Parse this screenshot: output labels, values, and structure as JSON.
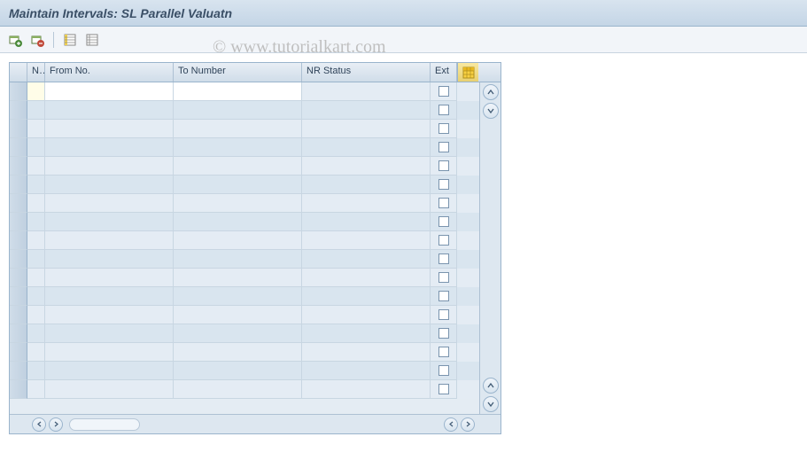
{
  "title": "Maintain Intervals: SL Parallel Valuatn",
  "watermark": "© www.tutorialkart.com",
  "toolbar": {
    "btn1_tip": "Insert Line",
    "btn2_tip": "Delete Line",
    "btn3_tip": "Select All",
    "btn4_tip": "Deselect All"
  },
  "table": {
    "headers": {
      "n": "N..",
      "from": "From No.",
      "to": "To Number",
      "nr": "NR Status",
      "ext": "Ext"
    },
    "rows": [
      {
        "n": "",
        "from": "",
        "to": "",
        "nr": "",
        "ext": false,
        "editable": true
      },
      {
        "n": "",
        "from": "",
        "to": "",
        "nr": "",
        "ext": false,
        "editable": false
      },
      {
        "n": "",
        "from": "",
        "to": "",
        "nr": "",
        "ext": false,
        "editable": false
      },
      {
        "n": "",
        "from": "",
        "to": "",
        "nr": "",
        "ext": false,
        "editable": false
      },
      {
        "n": "",
        "from": "",
        "to": "",
        "nr": "",
        "ext": false,
        "editable": false
      },
      {
        "n": "",
        "from": "",
        "to": "",
        "nr": "",
        "ext": false,
        "editable": false
      },
      {
        "n": "",
        "from": "",
        "to": "",
        "nr": "",
        "ext": false,
        "editable": false
      },
      {
        "n": "",
        "from": "",
        "to": "",
        "nr": "",
        "ext": false,
        "editable": false
      },
      {
        "n": "",
        "from": "",
        "to": "",
        "nr": "",
        "ext": false,
        "editable": false
      },
      {
        "n": "",
        "from": "",
        "to": "",
        "nr": "",
        "ext": false,
        "editable": false
      },
      {
        "n": "",
        "from": "",
        "to": "",
        "nr": "",
        "ext": false,
        "editable": false
      },
      {
        "n": "",
        "from": "",
        "to": "",
        "nr": "",
        "ext": false,
        "editable": false
      },
      {
        "n": "",
        "from": "",
        "to": "",
        "nr": "",
        "ext": false,
        "editable": false
      },
      {
        "n": "",
        "from": "",
        "to": "",
        "nr": "",
        "ext": false,
        "editable": false
      },
      {
        "n": "",
        "from": "",
        "to": "",
        "nr": "",
        "ext": false,
        "editable": false
      },
      {
        "n": "",
        "from": "",
        "to": "",
        "nr": "",
        "ext": false,
        "editable": false
      },
      {
        "n": "",
        "from": "",
        "to": "",
        "nr": "",
        "ext": false,
        "editable": false
      }
    ]
  }
}
